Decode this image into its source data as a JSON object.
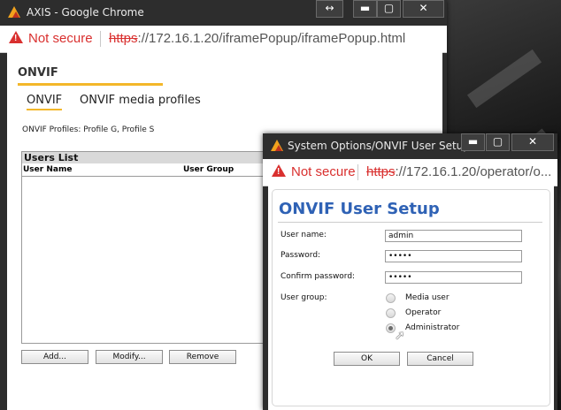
{
  "main_window": {
    "title": "AXIS - Google Chrome",
    "security": "Not secure",
    "url_scheme": "https",
    "url_rest": "://172.16.1.20/iframePopup/iframePopup.html",
    "controls": {
      "resize": "↔",
      "minimize": "▬",
      "maximize": "▢",
      "close": "✕"
    },
    "page_title": "ONVIF",
    "tabs": [
      "ONVIF",
      "ONVIF media profiles"
    ],
    "profiles_text": "ONVIF Profiles: Profile G, Profile S",
    "users_list": {
      "title": "Users List",
      "columns": [
        "User Name",
        "User Group"
      ]
    },
    "buttons": {
      "add": "Add...",
      "modify": "Modify...",
      "remove": "Remove"
    }
  },
  "popup_window": {
    "title": "System Options/ONVIF User Setup...",
    "security": "Not secure",
    "url_scheme": "https",
    "url_rest": "://172.16.1.20/operator/o...",
    "controls": {
      "minimize": "▬",
      "maximize": "▢",
      "close": "✕"
    },
    "heading": "ONVIF User Setup",
    "fields": {
      "username_label": "User name:",
      "username_value": "admin",
      "password_label": "Password:",
      "password_value": "•••••",
      "confirm_label": "Confirm password:",
      "confirm_value": "•••••"
    },
    "user_group_label": "User group:",
    "user_groups": [
      "Media user",
      "Operator",
      "Administrator"
    ],
    "selected_group": "Administrator",
    "buttons": {
      "ok": "OK",
      "cancel": "Cancel"
    }
  },
  "colors": {
    "accent": "#f3b72a",
    "heading_blue": "#2f62b5",
    "warning_red": "#d9302f"
  }
}
